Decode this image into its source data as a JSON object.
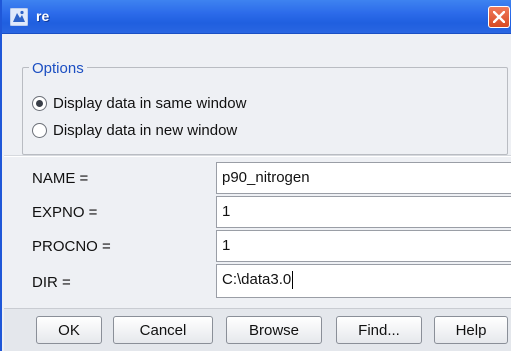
{
  "window": {
    "title": "re",
    "close_icon": "close-icon",
    "app_icon": "app-icon"
  },
  "options": {
    "legend": "Options",
    "radios": [
      {
        "label": "Display data in same window",
        "checked": true
      },
      {
        "label": "Display data in new window",
        "checked": false
      }
    ]
  },
  "params": {
    "name": {
      "label": "NAME =",
      "value": "p90_nitrogen"
    },
    "expno": {
      "label": "EXPNO =",
      "value": "1"
    },
    "procno": {
      "label": "PROCNO =",
      "value": "1"
    },
    "dir": {
      "label": "DIR =",
      "value": "C:\\data3.0"
    }
  },
  "buttons": {
    "ok": "OK",
    "cancel": "Cancel",
    "browse": "Browse",
    "find": "Find...",
    "help": "Help"
  },
  "colors": {
    "titlebar": "#2c6bea",
    "legend_text": "#1c4fc2",
    "close_button": "#d84a23"
  }
}
